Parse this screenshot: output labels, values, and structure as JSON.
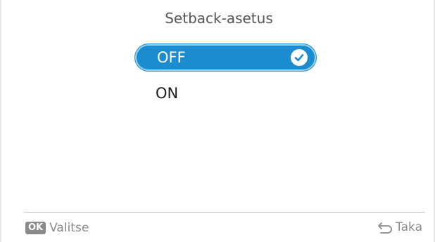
{
  "screen": {
    "title": "Setback-asetus"
  },
  "options": [
    {
      "label": "OFF",
      "selected": true
    },
    {
      "label": "ON",
      "selected": false
    }
  ],
  "footer": {
    "ok_badge": "OK",
    "select_label": "Valitse",
    "back_label": "Taka",
    "back_icon": "back-arrow-icon"
  },
  "colors": {
    "accent": "#1a8ccf",
    "accent_outline": "#9fd1ef",
    "footer_text": "#8a8a8a"
  }
}
